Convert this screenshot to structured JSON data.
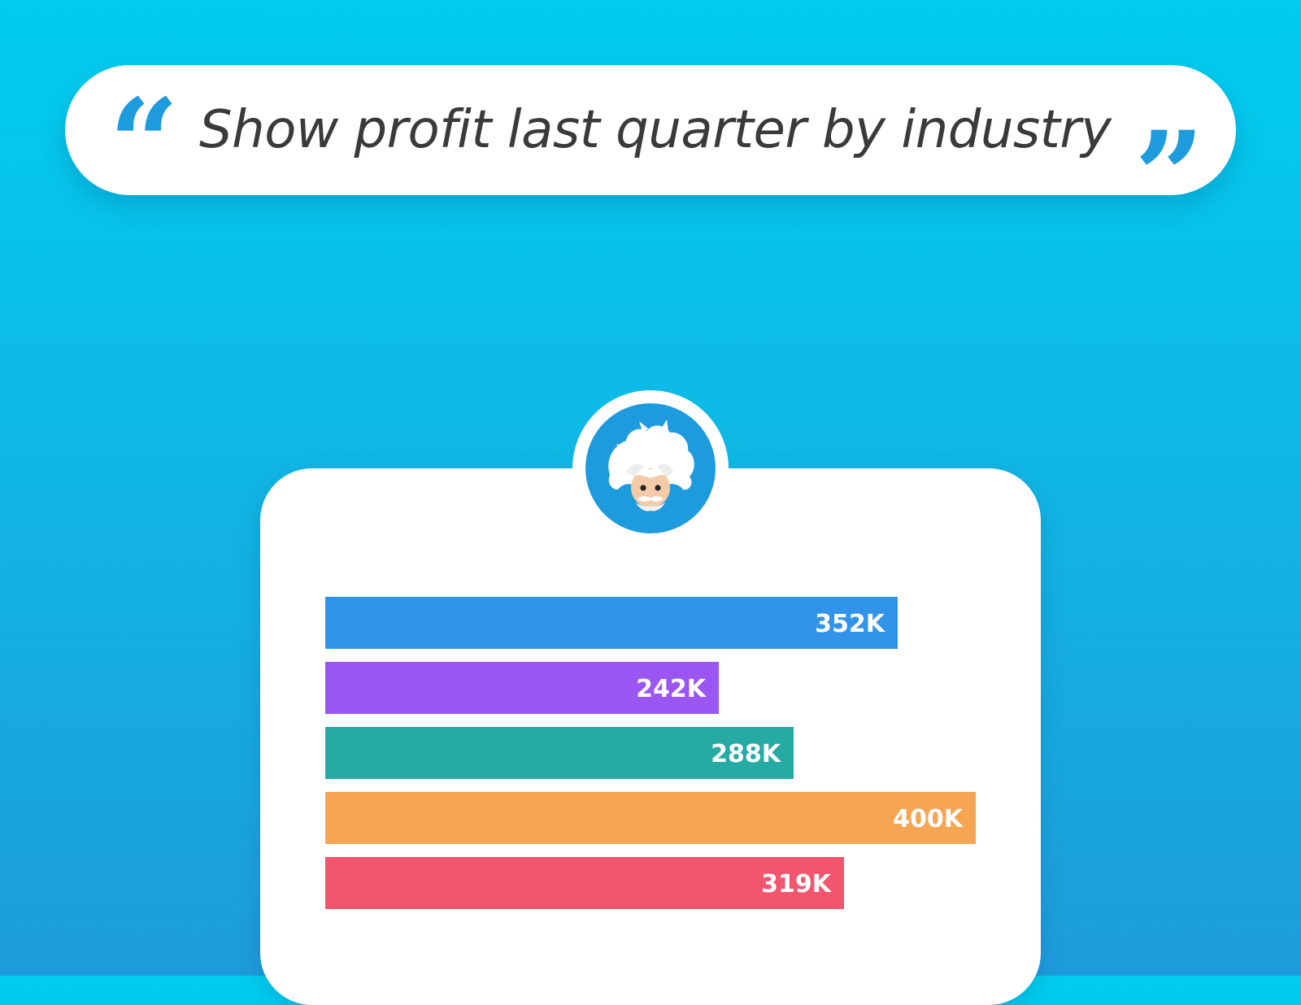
{
  "query": {
    "open_quote": "“",
    "text": "Show profit last quarter by industry",
    "close_quote": "”",
    "quote_color": "#1E9BDC"
  },
  "assistant": {
    "avatar_icon": "einstein-avatar-icon",
    "ring_color": "#FFFFFF",
    "background_color": "#1E9BDC"
  },
  "chart_data": {
    "type": "bar",
    "orientation": "horizontal",
    "categories": [],
    "values": [
      352,
      242,
      288,
      400,
      319
    ],
    "value_labels": [
      "352K",
      "242K",
      "288K",
      "400K",
      "319K"
    ],
    "colors": [
      "#3294E8",
      "#9B55F2",
      "#26AAA4",
      "#F6A552",
      "#F2566E"
    ],
    "xlim": [
      0,
      400
    ],
    "grid": false,
    "legend": "none"
  }
}
